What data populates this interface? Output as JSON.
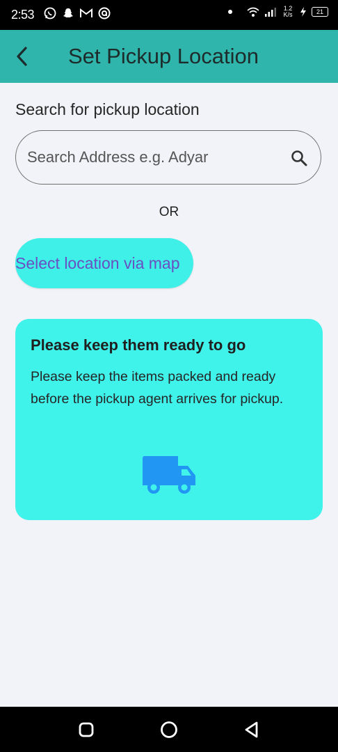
{
  "status_bar": {
    "time": "2:53",
    "network_speed_top": "1.2",
    "network_speed_unit": "K/s",
    "battery": "21",
    "icons": [
      "whatsapp-icon",
      "snapchat-icon",
      "gmail-icon",
      "app-icon",
      "notification-dot",
      "wifi-icon",
      "signal-icon",
      "charging-icon",
      "battery-icon"
    ]
  },
  "app_bar": {
    "title": "Set Pickup Location",
    "back_icon": "chevron-left-icon",
    "background_color": "#2fb5ab"
  },
  "search": {
    "label": "Search for pickup location",
    "placeholder": "Search Address e.g. Adyar",
    "icon": "search-icon"
  },
  "divider_text": "OR",
  "map_button": {
    "label": "Select location via map",
    "background_color": "#3ef0e8",
    "text_color": "#6b4ec2"
  },
  "info_card": {
    "title": "Please keep them ready to go",
    "body": "Please keep the items packed and ready before the pickup agent arrives for pickup.",
    "icon": "truck-icon",
    "icon_color": "#2196f3",
    "background_color": "#3ff2ea"
  },
  "nav_bar": {
    "buttons": [
      "recents-icon",
      "home-icon",
      "back-icon"
    ]
  }
}
